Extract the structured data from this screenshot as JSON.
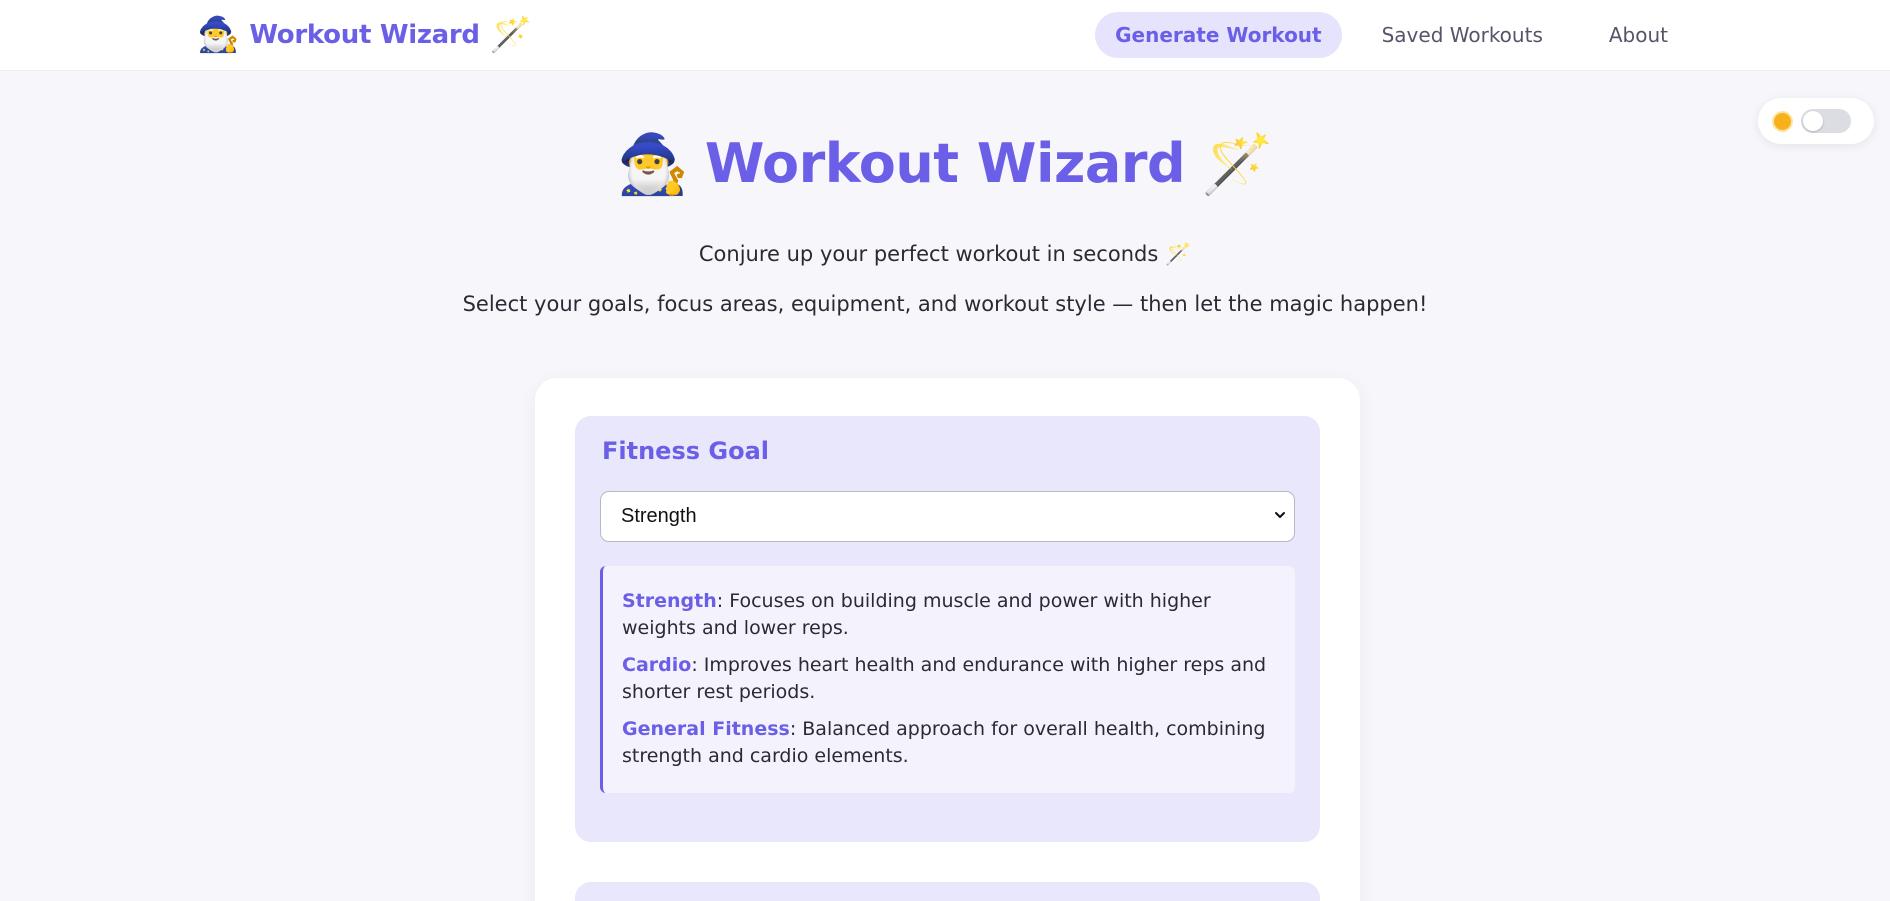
{
  "nav": {
    "brand_emoji_left": "🧙‍♂️",
    "brand_text": "Workout Wizard",
    "brand_emoji_right": "🪄",
    "links": [
      {
        "label": "Generate Workout",
        "active": true
      },
      {
        "label": "Saved Workouts",
        "active": false
      },
      {
        "label": "About",
        "active": false
      }
    ]
  },
  "theme_toggle": {
    "icon": "sun-icon",
    "dark_mode": false
  },
  "hero": {
    "emoji_left": "🧙‍♂️",
    "title": "Workout Wizard",
    "emoji_right": "🪄",
    "tagline": "Conjure up your perfect workout in seconds 🪄",
    "subtitle": "Select your goals, focus areas, equipment, and workout style — then let the magic happen!"
  },
  "fitness_goal": {
    "title": "Fitness Goal",
    "selected": "Strength",
    "descriptions": [
      {
        "term": "Strength",
        "text": ": Focuses on building muscle and power with higher weights and lower reps."
      },
      {
        "term": "Cardio",
        "text": ": Improves heart health and endurance with higher reps and shorter rest periods."
      },
      {
        "term": "General Fitness",
        "text": ": Balanced approach for overall health, combining strength and cardio elements."
      }
    ]
  },
  "colors": {
    "accent": "#6a5fe6",
    "accent_light": "#e6e4fc",
    "section_bg": "#e8e7fc",
    "page_bg": "#f7f7fb"
  }
}
